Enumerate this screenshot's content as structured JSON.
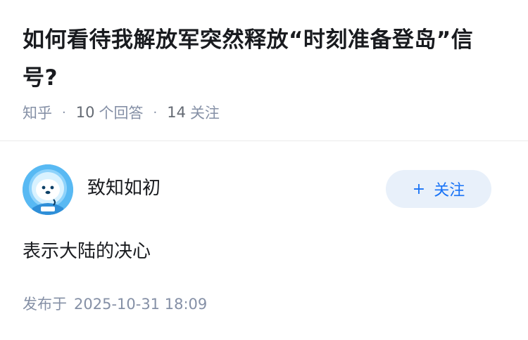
{
  "question": {
    "title": "如何看待我解放军突然释放“时刻准备登岛”信号?"
  },
  "meta": {
    "source": "知乎",
    "answers_count": "10",
    "answers_label": "个回答",
    "followers_count": "14",
    "followers_label": "关注"
  },
  "author": {
    "name": "致知如初",
    "follow_label": "关注",
    "follow_icon": "plus-icon"
  },
  "answer": {
    "text": "表示大陆的决心"
  },
  "publish": {
    "label": "发布于",
    "time": "2025-10-31 18:09"
  },
  "colors": {
    "accent": "#1772f6",
    "muted": "#8590a6",
    "button_bg": "#e8f0fa"
  }
}
